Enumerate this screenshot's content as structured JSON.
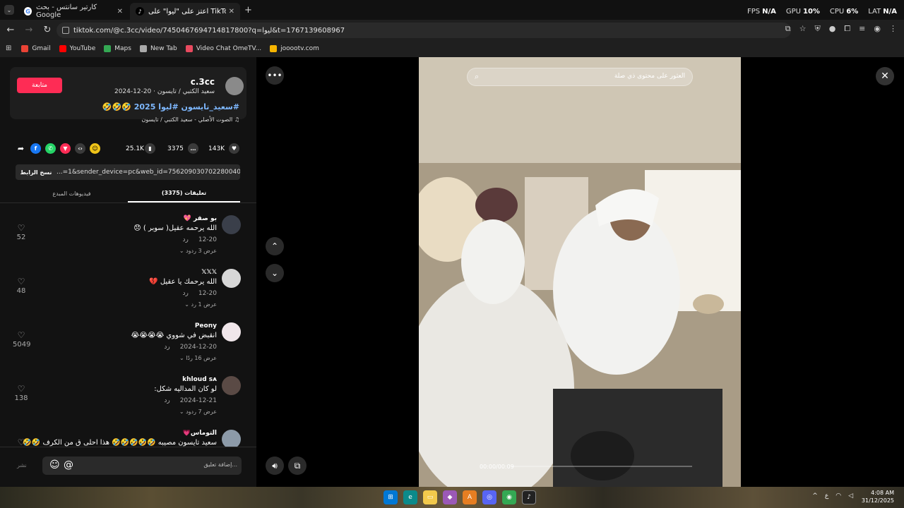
{
  "browser": {
    "tabs": [
      {
        "title": "كارتير سانتس - بحث Google",
        "close": "✕"
      },
      {
        "title": "اعتز على \"ليوا\" على TikTok | 🔊",
        "close": "✕"
      }
    ],
    "new_tab": "+",
    "url": "tiktok.com/@c.3cc/video/7450467694714817800?q=ليوا&t=1767139608967",
    "stats": {
      "fps_label": "FPS",
      "fps": "N/A",
      "gpu_label": "GPU",
      "gpu": "10%",
      "cpu_label": "CPU",
      "cpu": "6%",
      "lat_label": "LAT",
      "lat": "N/A"
    },
    "bookmarks": [
      {
        "label": "Gmail",
        "color": "#ea4335"
      },
      {
        "label": "YouTube",
        "color": "#ff0000"
      },
      {
        "label": "Maps",
        "color": "#34a853"
      },
      {
        "label": "New Tab",
        "color": "#aaaaaa"
      },
      {
        "label": "Video Chat OmeTV...",
        "color": "#e84a5f"
      },
      {
        "label": "joooo​tv.com",
        "color": "#f5b400"
      }
    ]
  },
  "post": {
    "username": "c.3cc",
    "subtitle": "سعيد الكتبي / تايسون · 20-12-2024",
    "follow_label": "متابعة",
    "caption": "#سعيد_تايسون #ليوا 2025 🤣🤣🤣",
    "sound": "الصوت الأصلي - سعيد الكتبي / تايسون",
    "likes": "143K",
    "comments": "3375",
    "saves": "25.1K",
    "copy_link_label": "نسخ الرابط",
    "share_url": "...=1&sender_device=pc&web_id=7562090307022800402",
    "tab_comments": "تعليقات (3375)",
    "tab_creator": "فيديوهات المبدع"
  },
  "comments": [
    {
      "name": "بو صقر 💖",
      "text": "الله يرحمه عقيل( سوبر ) 😞",
      "date": "12-20",
      "reply": "رد",
      "more": "عرض 3 ردود",
      "likes": "52",
      "avatar": "#3a3f4a"
    },
    {
      "name": "𝕏𝕏𝕏",
      "text": "الله يرحمك يا عقيل 💔",
      "date": "12-20",
      "reply": "رد",
      "more": "عرض 1 رد",
      "likes": "48",
      "avatar": "#d7d7d7"
    },
    {
      "name": "Peony",
      "text": "انقبض في شووي 😭😭😭😭",
      "date": "2024-12-20",
      "reply": "رد",
      "more": "عرض 16 ردًا",
      "likes": "5049",
      "avatar": "#f0e6ea"
    },
    {
      "name": "khloud ꜱᴀ",
      "text": "لو كان المداليه شكل:",
      "date": "2024-12-21",
      "reply": "رد",
      "more": "عرض 7 ردود",
      "likes": "138",
      "avatar": "#5a4a45"
    },
    {
      "name": "التوماس💗",
      "text": "سعيد تايسون مصيبه 🤣🤣🤣🤣🤣 هذا احلى ق من الكرف 🤣🤣",
      "date": "",
      "reply": "",
      "more": "",
      "likes": "",
      "avatar": "#8c9aa8"
    }
  ],
  "input": {
    "placeholder": "إضافة تعليق...",
    "publish": "نشر"
  },
  "video": {
    "search_placeholder": "العثور على محتوى ذي صلة",
    "time": "00:00/00:09",
    "progress": 0.0
  },
  "taskbar": {
    "time": "4:08 AM",
    "date": "31/12/2025",
    "lang": "ع"
  }
}
